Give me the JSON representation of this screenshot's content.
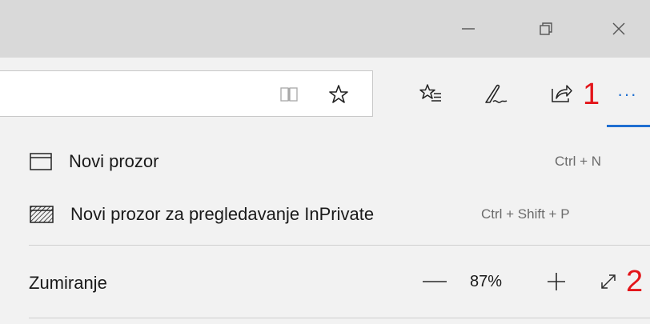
{
  "window_controls": {
    "minimize_icon": "minimize-icon",
    "restore_icon": "restore-icon",
    "close_icon": "close-icon"
  },
  "toolbar": {
    "reading_view_icon": "reading-view-icon",
    "favorite_star_icon": "star-icon",
    "favorites_hub_icon": "favorites-list-icon",
    "web_note_icon": "pen-icon",
    "share_icon": "share-icon",
    "more_label": "···",
    "annotation_1": "1",
    "accent_color": "#1f6fd1",
    "annotation_color": "#e3151a"
  },
  "menu": {
    "items": [
      {
        "label": "Novi prozor",
        "shortcut": "Ctrl + N",
        "icon": "window-icon"
      },
      {
        "label": "Novi prozor za pregledavanje InPrivate",
        "shortcut": "Ctrl + Shift + P",
        "icon": "inprivate-window-icon"
      }
    ],
    "zoom": {
      "label": "Zumiranje",
      "minus": "—",
      "value": "87%",
      "plus": "+",
      "fullscreen_icon": "fullscreen-icon",
      "annotation_2": "2"
    }
  }
}
